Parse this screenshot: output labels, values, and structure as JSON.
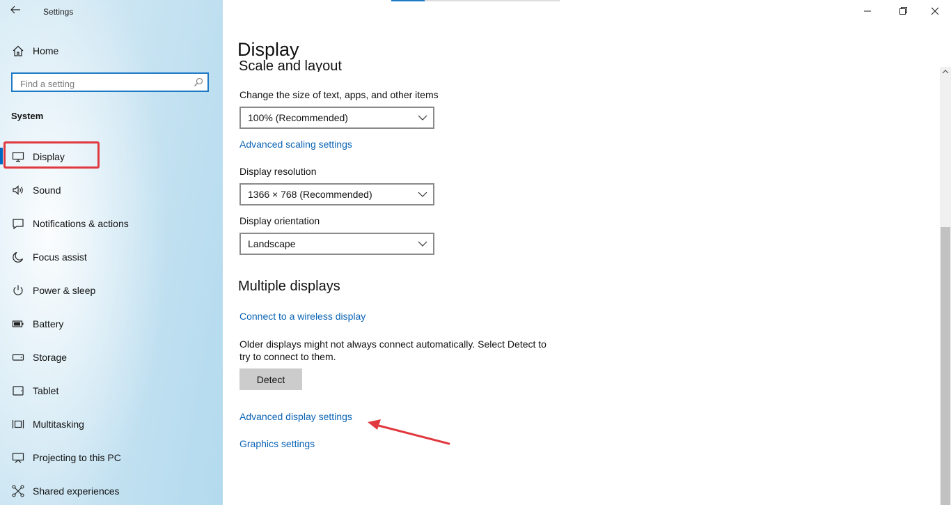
{
  "window": {
    "title": "Settings",
    "controls": [
      "minimize-icon",
      "maximize-icon",
      "close-icon"
    ]
  },
  "sidebar": {
    "home_label": "Home",
    "search_placeholder": "Find a setting",
    "group_label": "System",
    "items": [
      {
        "label": "Display",
        "icon": "monitor-icon",
        "selected": true
      },
      {
        "label": "Sound",
        "icon": "speaker-icon"
      },
      {
        "label": "Notifications & actions",
        "icon": "message-icon"
      },
      {
        "label": "Focus assist",
        "icon": "moon-icon"
      },
      {
        "label": "Power & sleep",
        "icon": "power-icon"
      },
      {
        "label": "Battery",
        "icon": "battery-icon"
      },
      {
        "label": "Storage",
        "icon": "drive-icon"
      },
      {
        "label": "Tablet",
        "icon": "tablet-icon"
      },
      {
        "label": "Multitasking",
        "icon": "multitasking-icon"
      },
      {
        "label": "Projecting to this PC",
        "icon": "projector-icon"
      },
      {
        "label": "Shared experiences",
        "icon": "share-icon"
      }
    ]
  },
  "main": {
    "title": "Display",
    "partial_heading": "Scale and layout",
    "scale_label": "Change the size of text, apps, and other items",
    "scale_value": "100% (Recommended)",
    "advanced_scaling_link": "Advanced scaling settings",
    "resolution_label": "Display resolution",
    "resolution_value": "1366 × 768 (Recommended)",
    "orientation_label": "Display orientation",
    "orientation_value": "Landscape",
    "multiple_heading": "Multiple displays",
    "wireless_link": "Connect to a wireless display",
    "detect_description": "Older displays might not always connect automatically. Select Detect to try to connect to them.",
    "detect_button": "Detect",
    "advanced_display_link": "Advanced display settings",
    "graphics_link": "Graphics settings"
  },
  "colors": {
    "accent": "#0067c0",
    "link": "#0a63b4",
    "annotation": "#e0393f"
  }
}
